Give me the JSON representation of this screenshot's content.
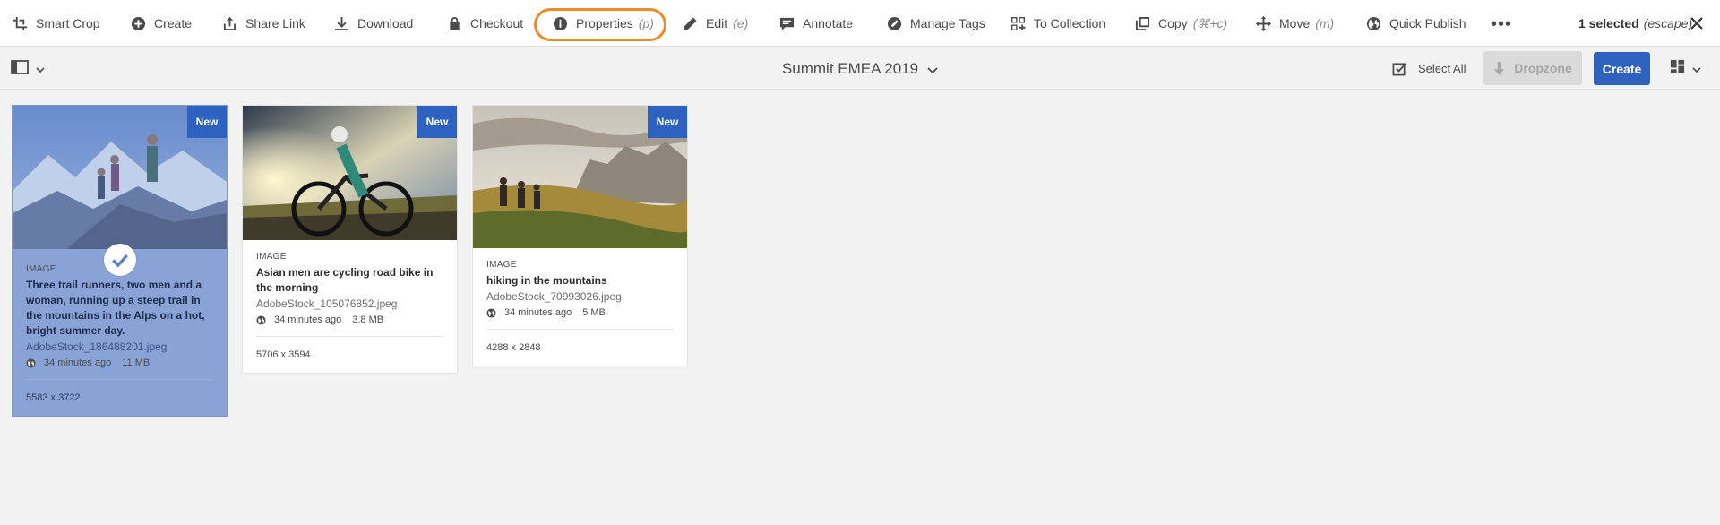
{
  "actionbar": {
    "items": [
      {
        "label": "Smart Crop",
        "shortcut": "",
        "icon": "smart-crop-icon"
      },
      {
        "label": "Create",
        "shortcut": "",
        "icon": "add-circle-icon"
      },
      {
        "label": "Share Link",
        "shortcut": "",
        "icon": "share-icon"
      },
      {
        "label": "Download",
        "shortcut": "",
        "icon": "download-icon"
      },
      {
        "label": "Checkout",
        "shortcut": "",
        "icon": "lock-icon"
      },
      {
        "label": "Properties",
        "shortcut": "(p)",
        "icon": "info-icon"
      },
      {
        "label": "Edit",
        "shortcut": "(e)",
        "icon": "pencil-icon"
      },
      {
        "label": "Annotate",
        "shortcut": "",
        "icon": "comment-icon"
      },
      {
        "label": "Manage Tags",
        "shortcut": "",
        "icon": "tag-icon"
      },
      {
        "label": "To Collection",
        "shortcut": "",
        "icon": "collection-add-icon"
      },
      {
        "label": "Copy",
        "shortcut": "(⌘+c)",
        "icon": "copy-icon"
      },
      {
        "label": "Move",
        "shortcut": "(m)",
        "icon": "move-icon"
      },
      {
        "label": "Quick Publish",
        "shortcut": "",
        "icon": "globe-publish-icon"
      }
    ],
    "more_icon": "more-icon",
    "selected_count": "1 selected",
    "escape_hint": "(escape)",
    "close_icon": "close-icon",
    "highlight_color": "#f08a24"
  },
  "titlebar": {
    "title": "Summit EMEA 2019",
    "select_all": "Select All",
    "dropzone": "Dropzone",
    "create": "Create",
    "accent": "#2e62c0"
  },
  "cards": [
    {
      "badge": "New",
      "type": "IMAGE",
      "title": "Three trail runners, two men and a woman, running up a steep trail in the mountains in the Alps on a hot, bright summer day.",
      "filename": "AdobeStock_186488201.jpeg",
      "modified": "34 minutes ago",
      "size": "11 MB",
      "dimensions": "5583 x 3722",
      "selected": true
    },
    {
      "badge": "New",
      "type": "IMAGE",
      "title": "Asian men are cycling road bike in the morning",
      "filename": "AdobeStock_105076852.jpeg",
      "modified": "34 minutes ago",
      "size": "3.8 MB",
      "dimensions": "5706 x 3594",
      "selected": false
    },
    {
      "badge": "New",
      "type": "IMAGE",
      "title": "hiking in the mountains",
      "filename": "AdobeStock_70993026.jpeg",
      "modified": "34 minutes ago",
      "size": "5 MB",
      "dimensions": "4288 x 2848",
      "selected": false
    }
  ]
}
